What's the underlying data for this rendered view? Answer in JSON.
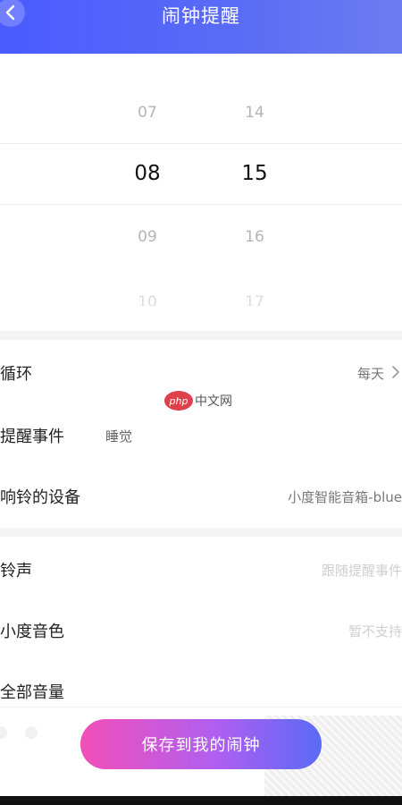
{
  "header": {
    "title": "闹钟提醒"
  },
  "picker": {
    "hours": {
      "above": "07",
      "selected": "08",
      "below": "09",
      "next": "10"
    },
    "minutes": {
      "above": "14",
      "selected": "15",
      "below": "16",
      "next": "17"
    }
  },
  "settings": {
    "repeat": {
      "label": "循环",
      "value": "每天"
    },
    "event": {
      "label": "提醒事件",
      "value": "睡觉"
    },
    "device": {
      "label": "响铃的设备",
      "value": "小度智能音箱-blue"
    },
    "ringtone": {
      "label": "铃声",
      "value": "跟随提醒事件"
    },
    "voice": {
      "label": "小度音色",
      "value": "暂不支持"
    },
    "volume": {
      "label": "全部音量"
    }
  },
  "watermark": {
    "logo": "php",
    "text": "中文网"
  },
  "footer": {
    "save_label": "保存到我的闹钟"
  }
}
